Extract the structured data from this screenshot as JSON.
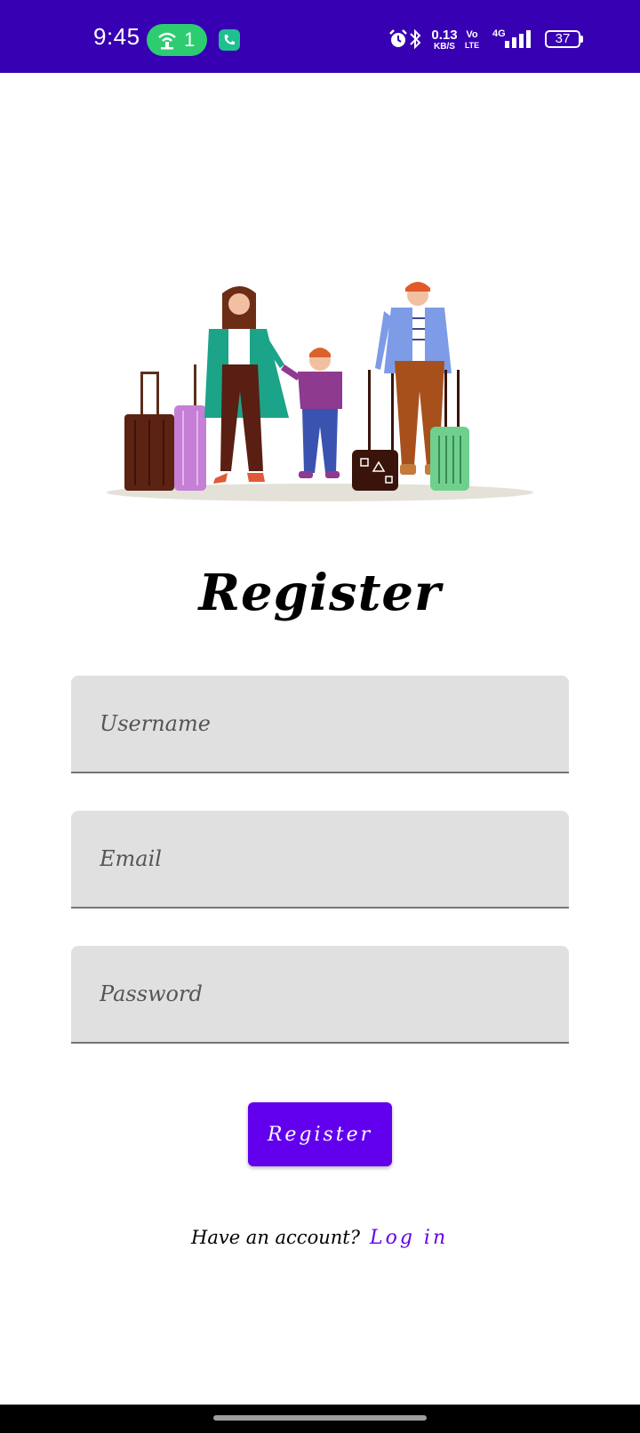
{
  "status_bar": {
    "time": "9:45",
    "hotspot_count": "1",
    "speed_value": "0.13",
    "speed_unit": "KB/S",
    "volte_top": "Vo",
    "volte_bottom": "LTE",
    "network": "4G",
    "battery": "37",
    "icons": [
      "hotspot-icon",
      "call-icon",
      "alarm-icon",
      "bluetooth-icon",
      "signal-icon",
      "battery-icon"
    ]
  },
  "illustration": {
    "icon": "family-travel-illustration"
  },
  "page": {
    "title": "Register"
  },
  "form": {
    "username": {
      "placeholder": "Username",
      "value": ""
    },
    "email": {
      "placeholder": "Email",
      "value": ""
    },
    "password": {
      "placeholder": "Password",
      "value": ""
    },
    "submit_label": "Register"
  },
  "footer": {
    "question": "Have an account?",
    "login_label": "Log in"
  },
  "colors": {
    "status_bar": "#3700b3",
    "primary": "#6200ee",
    "field_bg": "#e0e0e0"
  }
}
